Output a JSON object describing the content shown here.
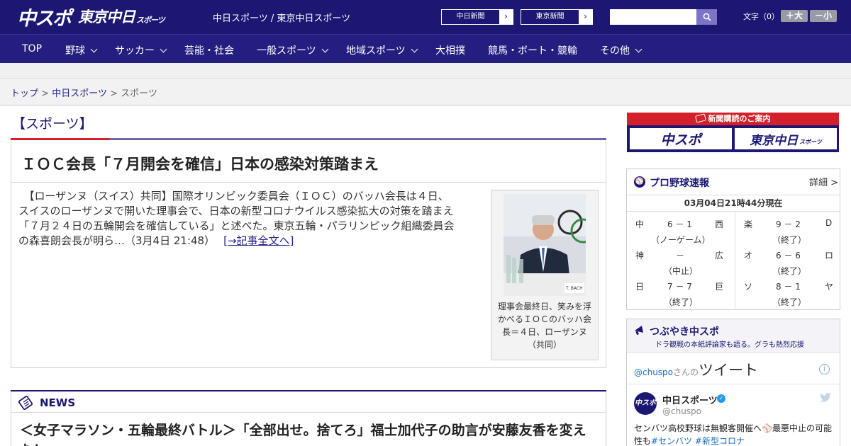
{
  "header": {
    "logo_primary": "中スポ",
    "logo_secondary": "東京中日",
    "logo_secondary_small": "スポーツ",
    "site_links": "中日スポーツ / 東京中日スポーツ",
    "newspaper_buttons": [
      {
        "label": "中日新聞",
        "arrow": "›"
      },
      {
        "label": "東京新聞",
        "arrow": "›"
      }
    ],
    "search_placeholder": "",
    "font_size_label": "文字（0）",
    "font_plus": "＋大",
    "font_minus": "－小"
  },
  "nav": {
    "items": [
      {
        "label": "TOP",
        "dropdown": false
      },
      {
        "label": "野球",
        "dropdown": true
      },
      {
        "label": "サッカー",
        "dropdown": true
      },
      {
        "label": "芸能・社会",
        "dropdown": false
      },
      {
        "label": "一般スポーツ",
        "dropdown": true
      },
      {
        "label": "地域スポーツ",
        "dropdown": true
      },
      {
        "label": "大相撲",
        "dropdown": false
      },
      {
        "label": "競馬・ボート・競輪",
        "dropdown": false
      },
      {
        "label": "その他",
        "dropdown": true
      }
    ]
  },
  "breadcrumb": {
    "items": [
      "トップ",
      "中日スポーツ",
      "スポーツ"
    ],
    "separator": ">"
  },
  "section": {
    "title": "【スポーツ】"
  },
  "article": {
    "headline": "ＩＯＣ会長「７月開会を確信」日本の感染対策踏まえ",
    "body_lines": [
      "　【ローザンヌ（スイス）共同】国際オリンピック委員会（ＩＯＣ）のバッハ会長は４日、",
      "スイスのローザンヌで開いた理事会で、日本の新型コロナウイルス感染拡大の対策を踏まえ",
      "「７月２４日の五輪開会を確信している」と述べた。東京五輪・パラリンピック組織委員会",
      "の森喜朗会長が明ら…（3月4日 21:48）"
    ],
    "more_link": "[→記事全文へ]",
    "photo_caption": "理事会最終日、笑みを浮かべるＩＯＣのバッハ会長＝４日、ローザンヌ（共同）",
    "photo_nameplate": "T. BACH"
  },
  "news": {
    "title": "NEWS",
    "items": [
      "＜女子マラソン・五輪最終バトル＞「全部出せ。捨てろ」福士加代子の助言が安藤友香を変えた！"
    ]
  },
  "subscription": {
    "head": "新聞購読のご案内",
    "logo_primary": "中スポ",
    "logo_secondary": "東京中日",
    "logo_secondary_small": "スポーツ"
  },
  "baseball": {
    "title": "プロ野球速報",
    "detail_link": "詳細 >",
    "updated": "03月04日21時44分現在",
    "games": [
      {
        "home": "中",
        "score": "6 － 1",
        "away": "西",
        "status": "（ノーゲーム）"
      },
      {
        "home": "神",
        "score": "－",
        "away": "広",
        "status": "（中止）"
      },
      {
        "home": "日",
        "score": "7 － 7",
        "away": "巨",
        "status": "（終了）"
      },
      {
        "home": "楽",
        "score": "9 － 2",
        "away": "D",
        "status": "（終了）"
      },
      {
        "home": "オ",
        "score": "6 － 6",
        "away": "ロ",
        "status": "（終了）"
      },
      {
        "home": "ソ",
        "score": "8 － 1",
        "away": "ヤ",
        "status": "（終了）"
      }
    ]
  },
  "twitter": {
    "title": "つぶやき中スポ",
    "subtitle": "ドラ観戦の本紙評論家も語る。グラも熱烈応援",
    "handle": "@chuspo",
    "handle_suffix": "さんの",
    "tweets_label": "ツイート",
    "account_name": "中日スポーツ",
    "account_handle": "@chuspo",
    "avatar_text": "中スポ",
    "tweet_text": "センバツ高校野球は無観客開催へ⚾最悪中止の可能性も",
    "tweet_tags": "#センバツ #新型コロナ"
  },
  "colors": {
    "brand_navy": "#1c1773",
    "accent_red": "#d4202a",
    "link_blue": "#23238e"
  }
}
